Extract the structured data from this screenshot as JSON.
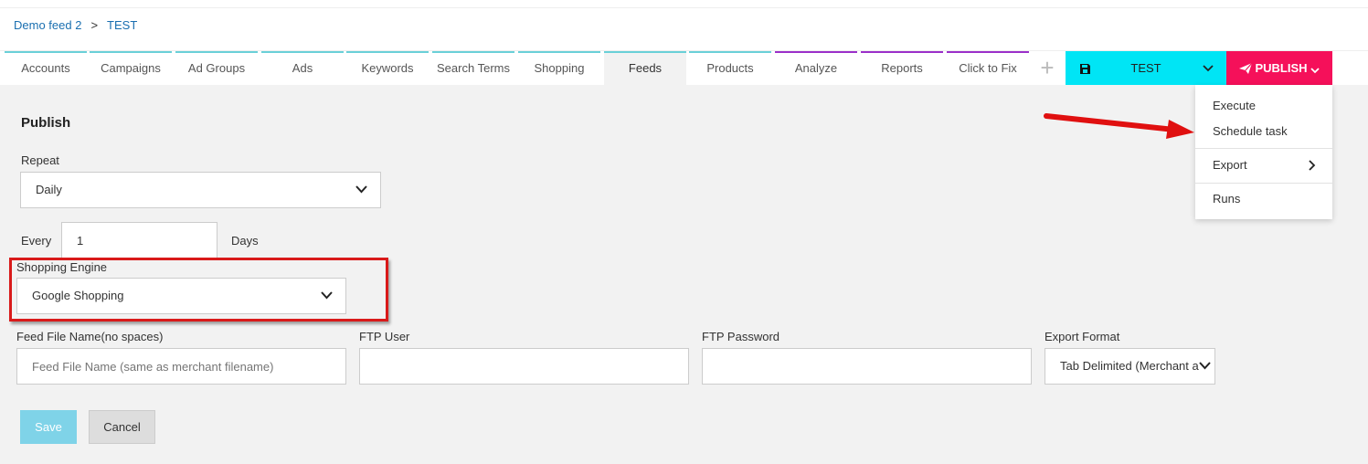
{
  "breadcrumb": {
    "parent": "Demo feed 2",
    "separator": ">",
    "current": "TEST"
  },
  "tabs": [
    {
      "label": "Accounts",
      "color": "#6ad0d8",
      "active": false
    },
    {
      "label": "Campaigns",
      "color": "#6ad0d8",
      "active": false
    },
    {
      "label": "Ad Groups",
      "color": "#6ad0d8",
      "active": false
    },
    {
      "label": "Ads",
      "color": "#6ad0d8",
      "active": false
    },
    {
      "label": "Keywords",
      "color": "#6ad0d8",
      "active": false
    },
    {
      "label": "Search Terms",
      "color": "#6ad0d8",
      "active": false
    },
    {
      "label": "Shopping",
      "color": "#6ad0d8",
      "active": false
    },
    {
      "label": "Feeds",
      "color": "#6ad0d8",
      "active": true
    },
    {
      "label": "Products",
      "color": "#6ad0d8",
      "active": false
    },
    {
      "label": "Analyze",
      "color": "#9b30c9",
      "active": false
    },
    {
      "label": "Reports",
      "color": "#9b30c9",
      "active": false
    },
    {
      "label": "Click to Fix",
      "color": "#9b30c9",
      "active": false
    }
  ],
  "add_tab_icon": "plus-icon",
  "feed_selector": {
    "name": "TEST",
    "icon": "save-icon",
    "color": "#00e5f5"
  },
  "publish_button": {
    "label": "PUBLISH",
    "icon": "paper-plane-icon",
    "color": "#f5105a"
  },
  "publish_menu": {
    "execute": "Execute",
    "schedule_task": "Schedule task",
    "export": "Export",
    "runs": "Runs"
  },
  "form": {
    "title": "Publish",
    "repeat_label": "Repeat",
    "repeat_value": "Daily",
    "every_label": "Every",
    "every_value": "1",
    "days_label": "Days",
    "shopping_engine_label": "Shopping Engine",
    "shopping_engine_value": "Google Shopping",
    "feed_file_name_label": "Feed File Name(no spaces)",
    "feed_file_name_placeholder": "Feed File Name (same as merchant filename)",
    "feed_file_name_value": "",
    "ftp_user_label": "FTP User",
    "ftp_user_value": "",
    "ftp_password_label": "FTP Password",
    "ftp_password_value": "",
    "export_format_label": "Export Format",
    "export_format_value": "Tab Delimited (Merchant a"
  },
  "buttons": {
    "save": "Save",
    "cancel": "Cancel"
  },
  "annotations": {
    "highlight_color": "#d91a1a",
    "arrow_color": "#e01010"
  }
}
